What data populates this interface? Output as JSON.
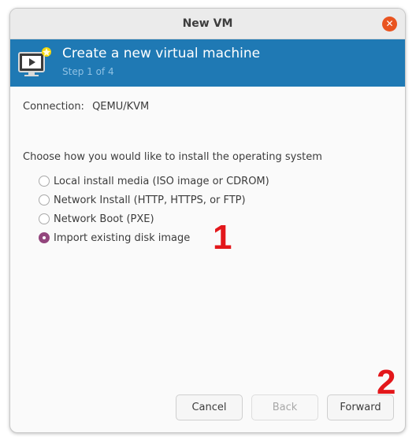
{
  "window": {
    "title": "New VM",
    "close_icon": "close-icon",
    "close_glyph": "✕"
  },
  "banner": {
    "title": "Create a new virtual machine",
    "step": "Step 1 of 4",
    "icon": "new-vm-icon",
    "background_color": "#1f79b4"
  },
  "connection": {
    "label": "Connection:",
    "value": "QEMU/KVM"
  },
  "install": {
    "prompt": "Choose how you would like to install the operating system",
    "options": [
      {
        "label": "Local install media (ISO image or CDROM)",
        "selected": false
      },
      {
        "label": "Network Install (HTTP, HTTPS, or FTP)",
        "selected": false
      },
      {
        "label": "Network Boot (PXE)",
        "selected": false
      },
      {
        "label": "Import existing disk image",
        "selected": true
      }
    ]
  },
  "buttons": {
    "cancel": "Cancel",
    "back": "Back",
    "forward": "Forward"
  },
  "annotations": {
    "one": "1",
    "two": "2",
    "color": "#e3171b"
  }
}
